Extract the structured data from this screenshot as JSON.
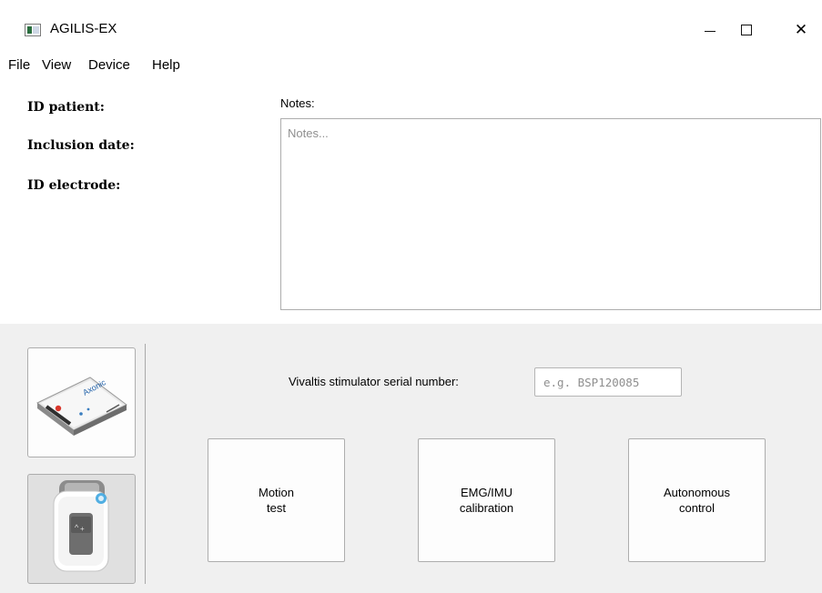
{
  "window": {
    "title": "AGILIS-EX",
    "app_icon": "app-window-icon",
    "controls": {
      "minimize": "minimize-icon",
      "maximize": "maximize-icon",
      "close": "✕"
    }
  },
  "menu": {
    "file": "File",
    "view": "View",
    "device": "Device",
    "help": "Help"
  },
  "patient": {
    "id_patient_label": "ID patient:",
    "inclusion_date_label": "Inclusion date:",
    "id_electrode_label": "ID electrode:"
  },
  "notes": {
    "label": "Notes:",
    "placeholder": "Notes...",
    "value": ""
  },
  "devices": [
    {
      "name": "Axonic stimulator",
      "icon": "axonic-device-image",
      "logo_text": "Axonic",
      "selected": false
    },
    {
      "name": "Vivaltis stimulator",
      "icon": "vivaltis-device-image",
      "selected": true
    }
  ],
  "serial": {
    "label": "Vivaltis stimulator serial number:",
    "placeholder": "e.g. BSP120085",
    "value": ""
  },
  "actions": {
    "motion_test": "Motion\ntest",
    "emg_imu_calibration": "EMG/IMU\ncalibration",
    "autonomous_control": "Autonomous\ncontrol"
  },
  "colors": {
    "panel_bg": "#f0f0f0",
    "selected_device_bg": "#e0e0e0",
    "accent_blue": "#33a1de"
  }
}
